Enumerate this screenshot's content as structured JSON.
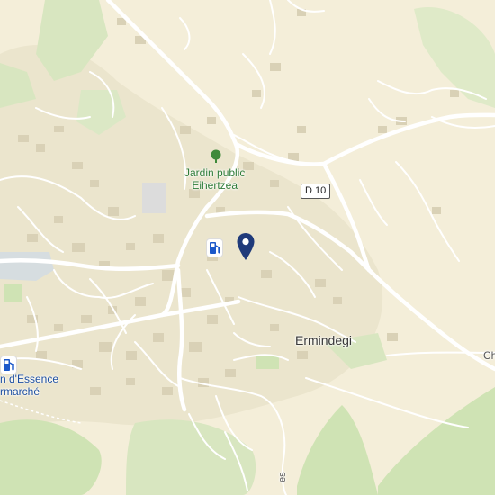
{
  "map": {
    "labels": {
      "park": "Jardin public\nEihertzea",
      "park_line1": "Jardin public",
      "park_line2": "Eihertzea",
      "road": "D 10",
      "place": "Ermindegi",
      "poi_line1": "n d'Essence",
      "poi_line2": "rmarché",
      "edge_right": "Ch",
      "edge_bottom": "es"
    },
    "icons": {
      "marker": "location-pin-icon",
      "fuel": "fuel-station-icon",
      "park": "tree-icon"
    },
    "colors": {
      "land": "#f4eed9",
      "urban": "#ebe5cd",
      "building": "#d9d1b6",
      "green": "#cfe3b4",
      "road": "#ffffff",
      "pin": "#1f3a7a",
      "fuel_icon": "#1b58c9"
    }
  }
}
